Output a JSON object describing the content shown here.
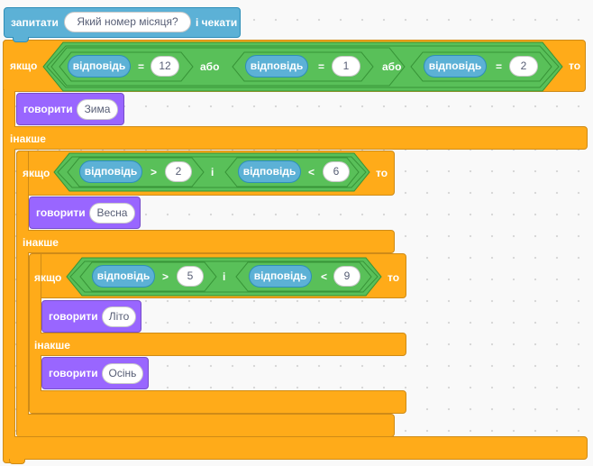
{
  "ask": {
    "label": "запитати",
    "question": "Який номер місяця?",
    "wait": "і чекати"
  },
  "if1": {
    "label": "якщо",
    "then": "то",
    "else": "інакше",
    "cond": {
      "a": {
        "reporter": "відповідь",
        "op": "=",
        "value": "12"
      },
      "or1": "або",
      "b": {
        "reporter": "відповідь",
        "op": "=",
        "value": "1"
      },
      "or2": "або",
      "c": {
        "reporter": "відповідь",
        "op": "=",
        "value": "2"
      }
    }
  },
  "say_winter": {
    "label": "говорити",
    "value": "Зима"
  },
  "if2": {
    "label": "якщо",
    "then": "то",
    "else": "інакше",
    "cond": {
      "a": {
        "reporter": "відповідь",
        "op": ">",
        "value": "2"
      },
      "and": "і",
      "b": {
        "reporter": "відповідь",
        "op": "<",
        "value": "6"
      }
    }
  },
  "say_spring": {
    "label": "говорити",
    "value": "Весна"
  },
  "if3": {
    "label": "якщо",
    "then": "то",
    "else": "інакше",
    "cond": {
      "a": {
        "reporter": "відповідь",
        "op": ">",
        "value": "5"
      },
      "and": "і",
      "b": {
        "reporter": "відповідь",
        "op": "<",
        "value": "9"
      }
    }
  },
  "say_summer": {
    "label": "говорити",
    "value": "Літо"
  },
  "say_autumn": {
    "label": "говорити",
    "value": "Осінь"
  },
  "colors": {
    "control": "#ffab19",
    "sensing": "#5cb1d6",
    "looks": "#9966ff",
    "operators": "#59c059",
    "canvas": "#f9f9f9"
  }
}
